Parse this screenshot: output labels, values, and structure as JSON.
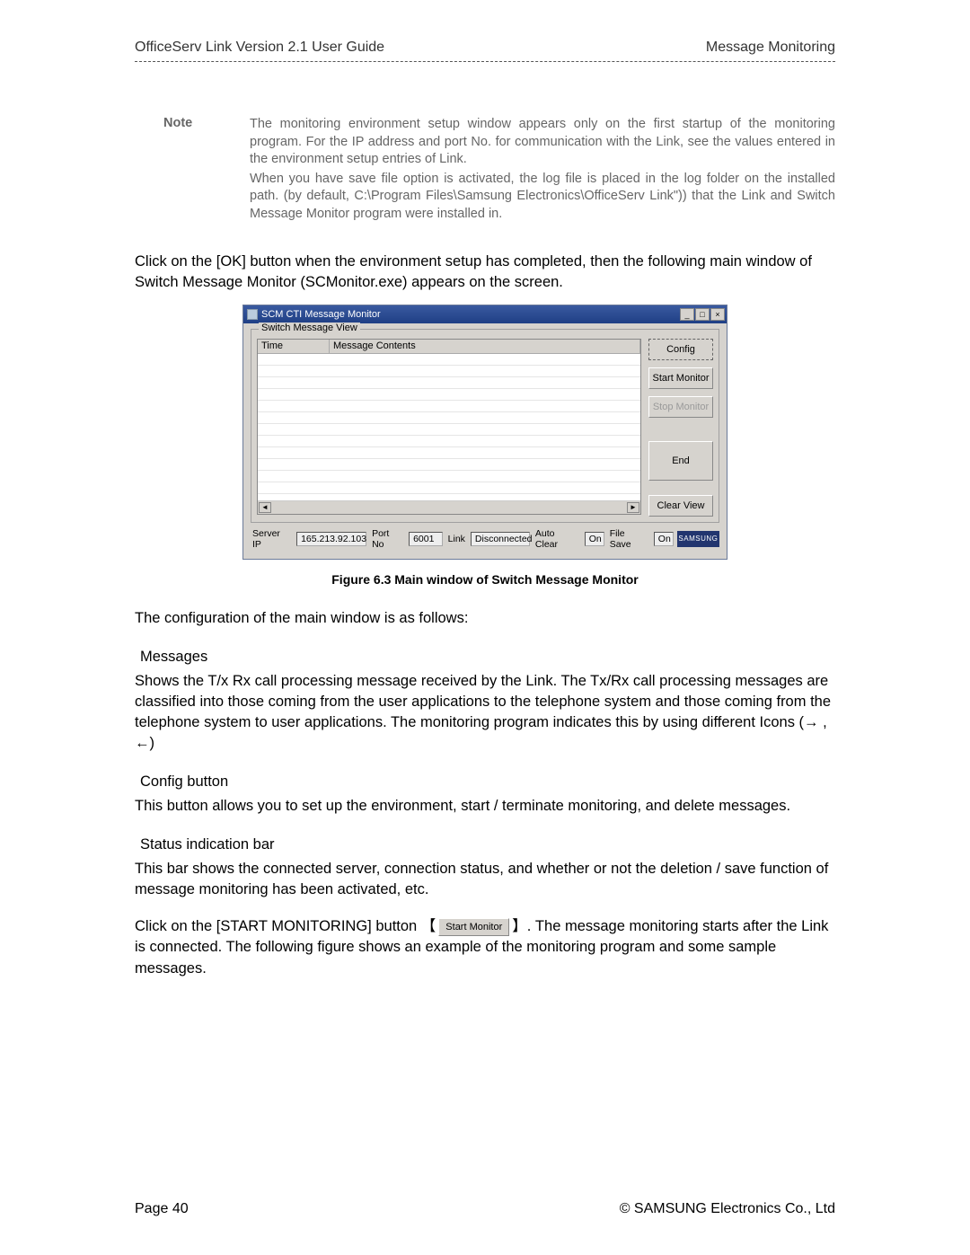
{
  "header": {
    "doc_title": "OfficeServ Link Version 2.1 User Guide",
    "section": "Message Monitoring"
  },
  "note": {
    "label": "Note",
    "p1": "The monitoring environment setup window appears only on the first startup of the monitoring program. For the IP address and port No. for communication with the Link, see the values entered in the environment setup entries of Link.",
    "p2": "When you have save file option is activated, the log file is placed in the log folder on the installed path. (by default, C:\\Program Files\\Samsung Electronics\\OfficeServ Link\")) that the Link and Switch Message Monitor program were installed in."
  },
  "para_intro": "Click on the [OK] button when the environment setup has completed, then the following main window of Switch Message Monitor (SCMonitor.exe) appears on the screen.",
  "app": {
    "title": "SCM CTI Message Monitor",
    "group_label": "Switch Message View",
    "columns": {
      "time": "Time",
      "contents": "Message Contents"
    },
    "buttons": {
      "config": "Config",
      "start": "Start Monitor",
      "stop": "Stop Monitor",
      "end": "End",
      "clear": "Clear View"
    },
    "status": {
      "server_ip_label": "Server IP",
      "server_ip": "165.213.92.103",
      "port_label": "Port No",
      "port": "6001",
      "link_label": "Link",
      "link": "Disconnected",
      "autoclear_label": "Auto Clear",
      "autoclear": "On",
      "filesave_label": "File Save",
      "filesave": "On"
    },
    "logo": "SAMSUNG",
    "win_min": "_",
    "win_max": "□",
    "win_close": "×"
  },
  "caption": "Figure 6.3 Main window of Switch Message Monitor",
  "para_config_intro": "The configuration of the main window is as follows:",
  "sections": {
    "messages_h": "Messages",
    "messages_p": "Shows the T/x Rx call processing message received by the Link. The Tx/Rx call processing messages are classified into those coming from the user applications to the telephone system and those coming from the telephone system to user applications. The monitoring program indicates this by using different Icons (→ , ←)",
    "config_h": "Config button",
    "config_p": "This button allows you to set up the environment, start / terminate monitoring, and delete messages.",
    "status_h": "Status indication bar",
    "status_p": "This bar shows the connected server, connection status, and whether or not the deletion / save function of message monitoring has been activated, etc."
  },
  "para_start_pre": "Click on the [START MONITORING] button 【",
  "inline_button_label": "Start Monitor",
  "para_start_post": "】. The message monitoring starts after the Link is connected. The following figure shows an example of the monitoring program and some sample messages.",
  "footer": {
    "page": "Page 40",
    "copyright": "© SAMSUNG Electronics Co., Ltd"
  }
}
